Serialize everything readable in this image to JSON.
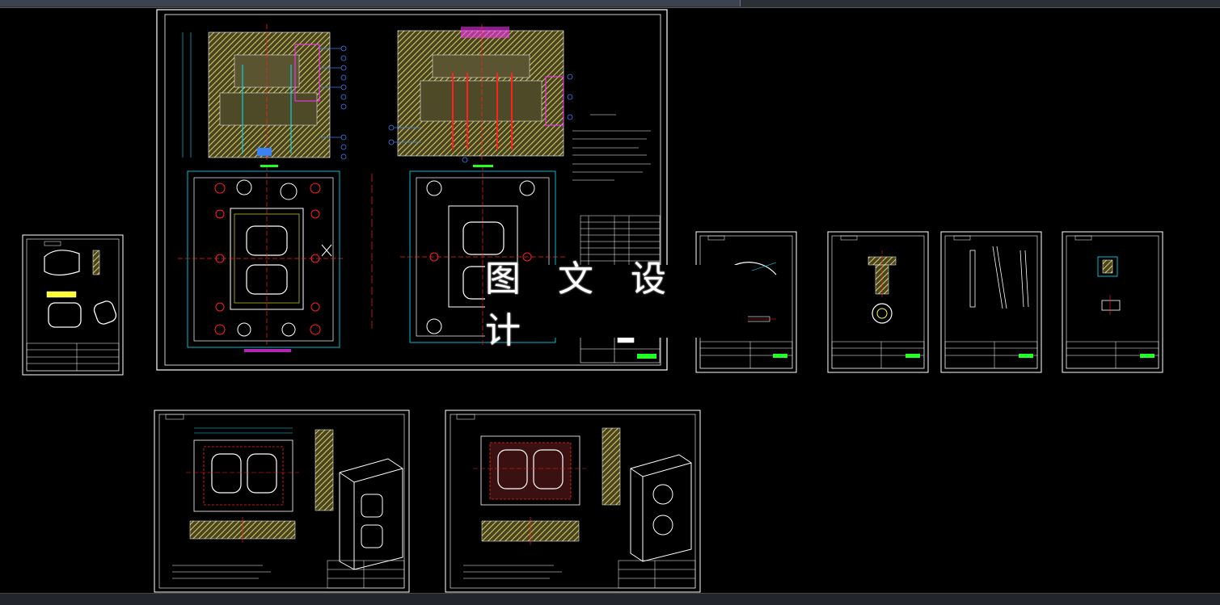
{
  "watermark": {
    "text": "图 文 设 计"
  },
  "colors": {
    "background": "#000000",
    "border": "#ffffff",
    "hatch": "#c9c46a",
    "cyan": "#00e5ff",
    "red": "#ff2020",
    "magenta": "#ff33ff",
    "blue": "#3b82f6",
    "green": "#22ff22",
    "yellow": "#ffff33"
  },
  "sheets": [
    {
      "id": "main-assembly",
      "kind": "assembly"
    },
    {
      "id": "part-left",
      "kind": "part"
    },
    {
      "id": "part-ring",
      "kind": "part"
    },
    {
      "id": "part-pin",
      "kind": "part"
    },
    {
      "id": "part-rods",
      "kind": "part"
    },
    {
      "id": "part-small",
      "kind": "part"
    },
    {
      "id": "cavity-plate",
      "kind": "part"
    },
    {
      "id": "core-plate",
      "kind": "part"
    }
  ]
}
